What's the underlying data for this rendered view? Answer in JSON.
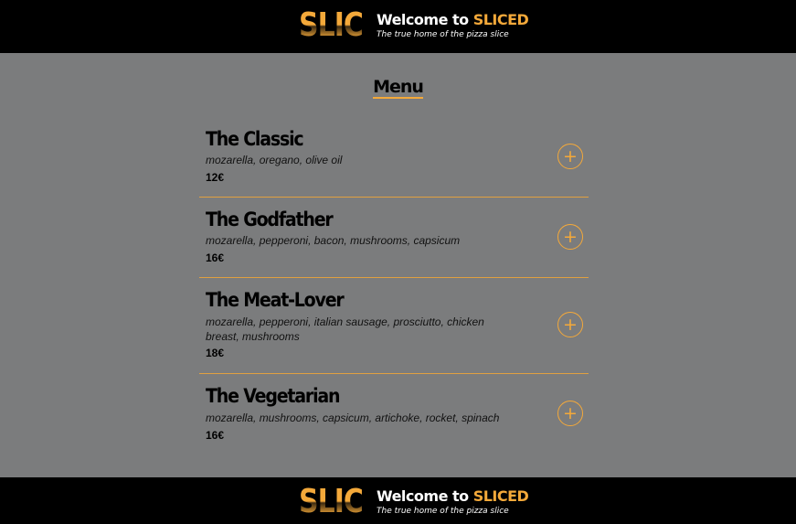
{
  "header": {
    "logo_text": "SLICED",
    "welcome_prefix": "Welcome to ",
    "welcome_brand": "SLICED",
    "tagline": "The true home of the pizza slice"
  },
  "menu": {
    "title": "Menu",
    "items": [
      {
        "name": "The Classic",
        "desc": "mozarella, oregano, olive oil",
        "price": "12€",
        "add_icon": "plus-icon"
      },
      {
        "name": "The Godfather",
        "desc": "mozarella, pepperoni, bacon, mushrooms, capsicum",
        "price": "16€",
        "add_icon": "plus-icon"
      },
      {
        "name": "The Meat-Lover",
        "desc": "mozarella, pepperoni, italian sausage, prosciutto, chicken breast, mushrooms",
        "price": "18€",
        "add_icon": "plus-icon"
      },
      {
        "name": "The Vegetarian",
        "desc": "mozarella, mushrooms, capsicum, artichoke, rocket, spinach",
        "price": "16€",
        "add_icon": "plus-icon"
      }
    ]
  },
  "footer": {
    "logo_text": "SLICED",
    "welcome_prefix": "Welcome to ",
    "welcome_brand": "SLICED",
    "tagline": "The true home of the pizza slice"
  },
  "colors": {
    "accent": "#f4a93a",
    "background": "#7b7c7d",
    "bar": "#000000"
  }
}
